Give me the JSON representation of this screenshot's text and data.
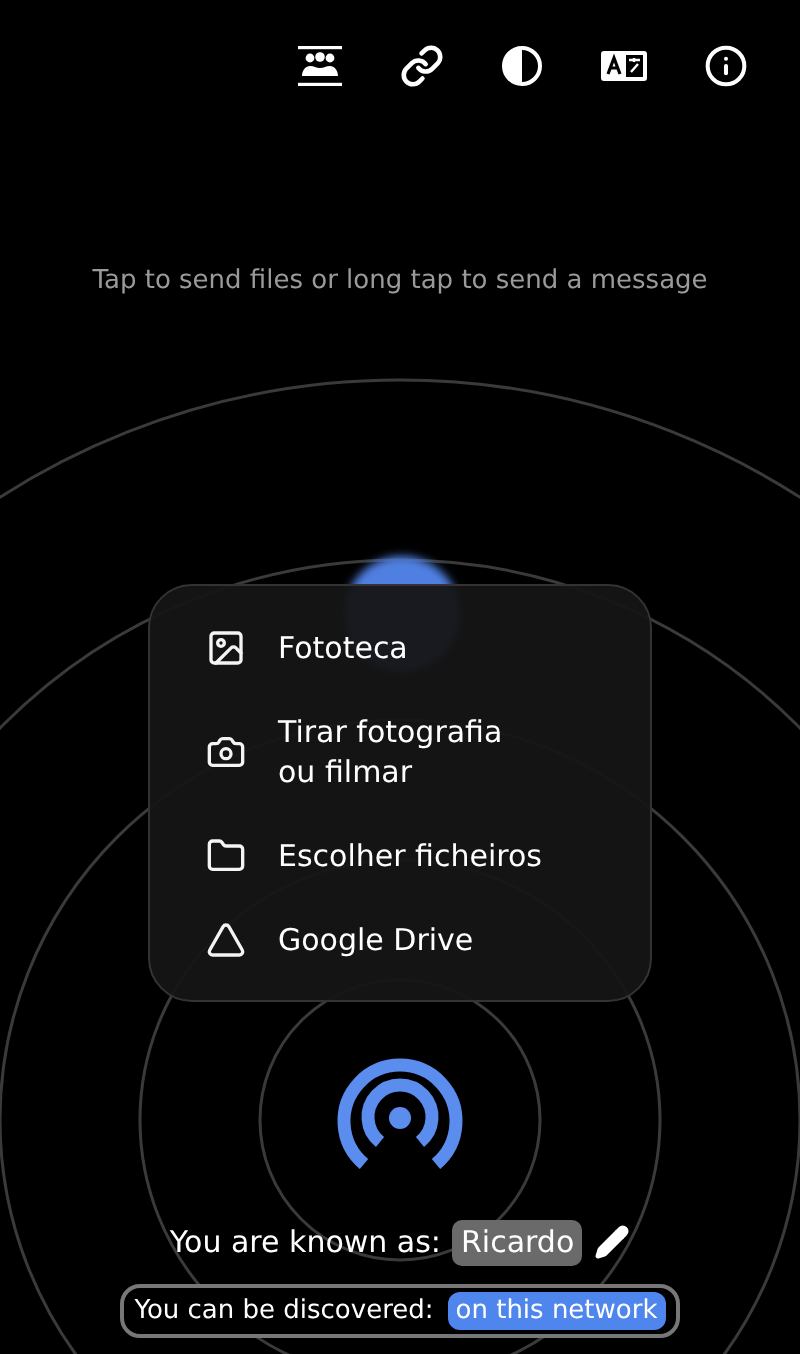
{
  "hint": "Tap to send files or long tap to send a message",
  "menu": [
    {
      "kind": "photos",
      "label": "Fototeca"
    },
    {
      "kind": "camera",
      "label": "Tirar fotografia\nou filmar"
    },
    {
      "kind": "folder",
      "label": "Escolher ficheiros"
    },
    {
      "kind": "drive",
      "label": "Google Drive"
    }
  ],
  "known_as": {
    "label": "You are known as:",
    "name": "Ricardo"
  },
  "discovery": {
    "label": "You can be discovered:",
    "value": "on this network"
  }
}
